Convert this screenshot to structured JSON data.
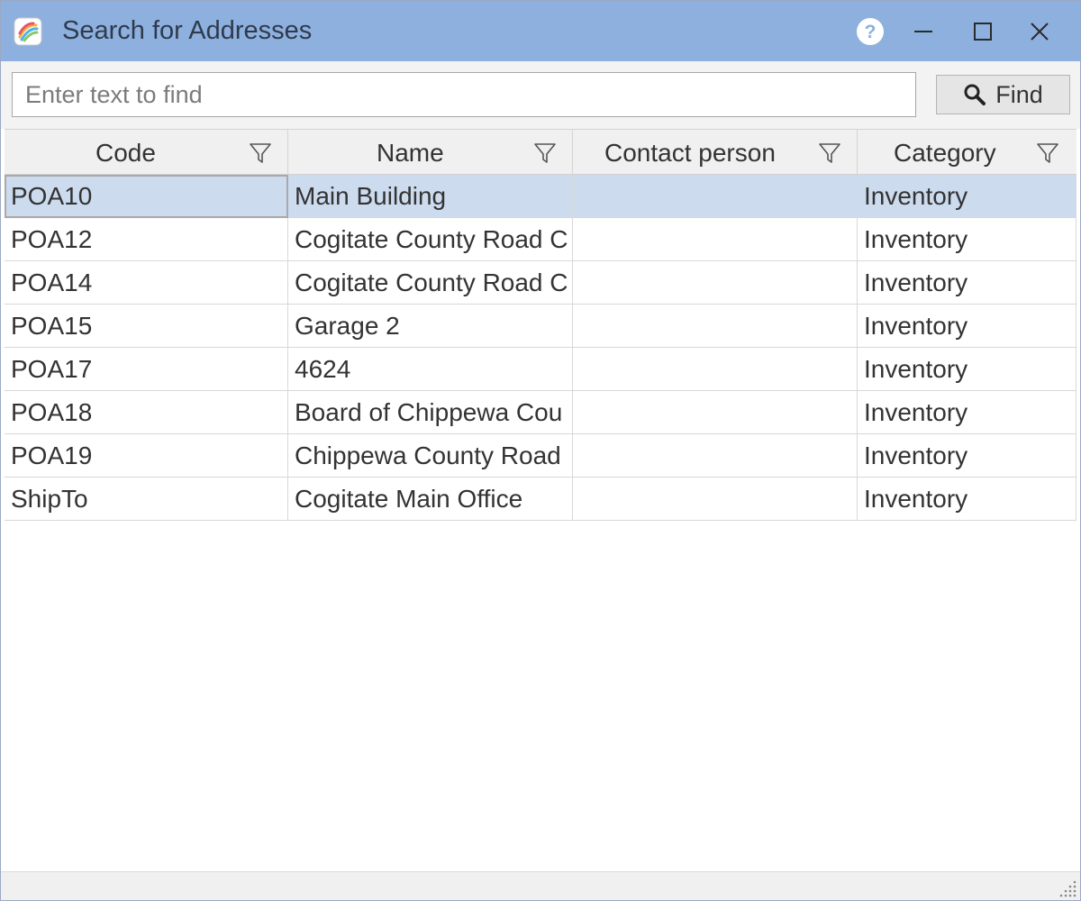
{
  "window": {
    "title": "Search for Addresses",
    "help_icon": "help-icon",
    "minimize_icon": "minimize-icon",
    "maximize_icon": "maximize-icon",
    "close_icon": "close-icon"
  },
  "search": {
    "placeholder": "Enter text to find",
    "value": "",
    "find_label": "Find",
    "find_icon": "search-icon"
  },
  "grid": {
    "columns": [
      {
        "label": "Code",
        "filter_icon": "filter-icon"
      },
      {
        "label": "Name",
        "filter_icon": "filter-icon"
      },
      {
        "label": "Contact person",
        "filter_icon": "filter-icon"
      },
      {
        "label": "Category",
        "filter_icon": "filter-icon"
      }
    ],
    "selected_row": 0,
    "rows": [
      {
        "code": "POA10",
        "name": "Main Building",
        "contact": "",
        "category": "Inventory"
      },
      {
        "code": "POA12",
        "name": "Cogitate County Road C",
        "contact": "",
        "category": "Inventory"
      },
      {
        "code": "POA14",
        "name": "Cogitate County Road C",
        "contact": "",
        "category": "Inventory"
      },
      {
        "code": "POA15",
        "name": "Garage 2",
        "contact": "",
        "category": "Inventory"
      },
      {
        "code": "POA17",
        "name": "4624",
        "contact": "",
        "category": "Inventory"
      },
      {
        "code": "POA18",
        "name": "Board of Chippewa Cou",
        "contact": "",
        "category": "Inventory"
      },
      {
        "code": "POA19",
        "name": "Chippewa County Road",
        "contact": "",
        "category": "Inventory"
      },
      {
        "code": "ShipTo",
        "name": "Cogitate Main Office",
        "contact": "",
        "category": "Inventory"
      }
    ]
  },
  "colors": {
    "titlebar": "#8eb0de",
    "selected_row": "#cddbef"
  }
}
